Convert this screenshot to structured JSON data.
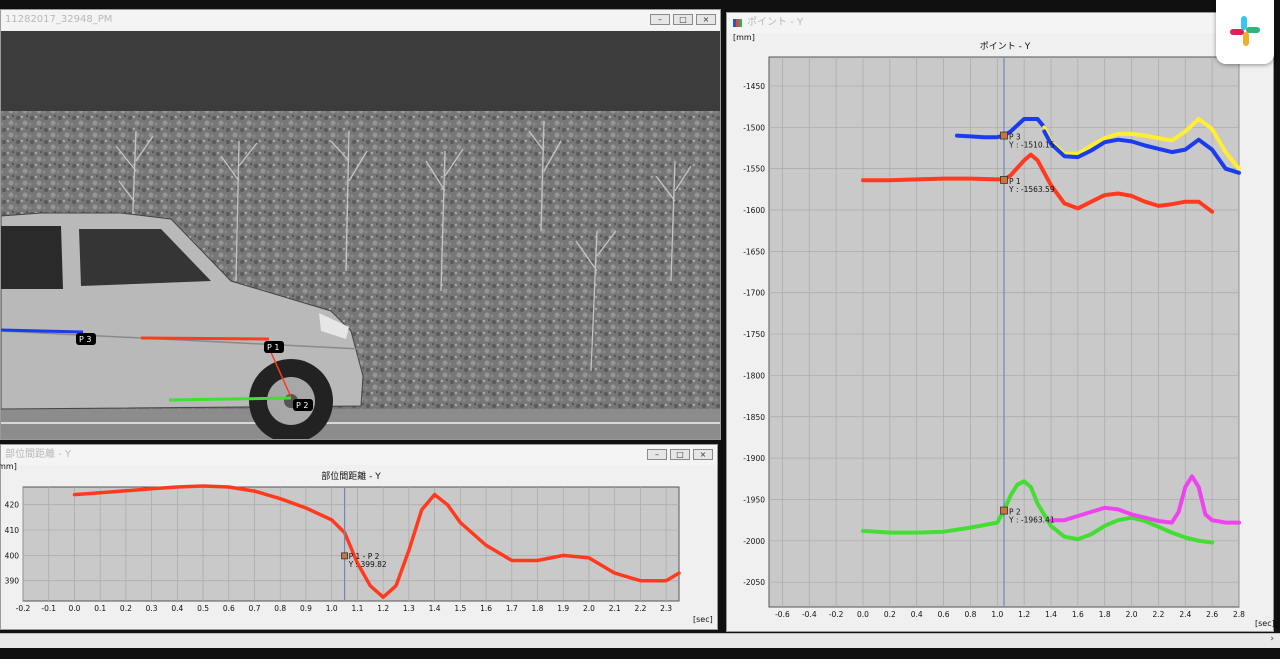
{
  "video_window": {
    "title": "11282017_32948_PM",
    "markers": {
      "p1": "P 1",
      "p2": "P 2",
      "p3": "P 3"
    }
  },
  "position_window": {
    "title": "ポイント - Y",
    "plot_title": "ポイント - Y",
    "y_unit": "[mm]",
    "x_unit": "[sec]",
    "x_ticks": [
      "-0.6",
      "-0.4",
      "-0.2",
      "0.0",
      "0.2",
      "0.4",
      "0.6",
      "0.8",
      "1.0",
      "1.2",
      "1.4",
      "1.6",
      "1.8",
      "2.0",
      "2.2",
      "2.4",
      "2.6",
      "2.8"
    ],
    "y_ticks": [
      "-1450",
      "-1500",
      "-1550",
      "-1600",
      "-1650",
      "-1700",
      "-1750",
      "-1800",
      "-1850",
      "-1900",
      "-1950",
      "-2000",
      "-2050"
    ],
    "cursors": [
      {
        "name": "P 3",
        "value": "Y : -1510.15"
      },
      {
        "name": "P 1",
        "value": "Y : -1563.59"
      },
      {
        "name": "P 2",
        "value": "Y : -1963.41"
      }
    ]
  },
  "distance_window": {
    "title": "部位間距離 - Y",
    "plot_title": "部位間距離 - Y",
    "y_unit": "[mm]",
    "x_unit": "[sec]",
    "x_ticks": [
      "-0.2",
      "-0.1",
      "0.0",
      "0.1",
      "0.2",
      "0.3",
      "0.4",
      "0.5",
      "0.6",
      "0.7",
      "0.8",
      "0.9",
      "1.0",
      "1.1",
      "1.2",
      "1.3",
      "1.4",
      "1.5",
      "1.6",
      "1.7",
      "1.8",
      "1.9",
      "2.0",
      "2.1",
      "2.2",
      "2.3"
    ],
    "y_ticks": [
      "420",
      "410",
      "400",
      "390"
    ],
    "cursor_name": "P 1 - P 2",
    "cursor_value": "Y : 399.82"
  },
  "colors": {
    "p1": "#ff3a1e",
    "p2": "#44dd33",
    "p3": "#1a3cf0",
    "yellow": "#ffee33",
    "magenta": "#ee44ee"
  },
  "chart_data": [
    {
      "type": "line",
      "title": "ポイント - Y",
      "xlim": [
        -0.7,
        2.8
      ],
      "ylim": [
        -2080,
        -1415
      ],
      "grid": true,
      "series": [
        {
          "name": "P 3",
          "x": [
            0.7,
            0.8,
            0.9,
            1.0,
            1.05,
            1.1,
            1.2,
            1.3,
            1.35
          ],
          "y": [
            -1510,
            -1511,
            -1512,
            -1512,
            -1510,
            -1505,
            -1490,
            -1490,
            -1500
          ]
        },
        {
          "name": "",
          "x": [
            1.35,
            1.4,
            1.5,
            1.6,
            1.7,
            1.8,
            1.9,
            2.0,
            2.1,
            2.2,
            2.3,
            2.4,
            2.5,
            2.6,
            2.7,
            2.8
          ],
          "y": [
            -1500,
            -1518,
            -1532,
            -1532,
            -1522,
            -1513,
            -1508,
            -1508,
            -1510,
            -1513,
            -1516,
            -1505,
            -1490,
            -1502,
            -1530,
            -1550
          ]
        },
        {
          "name": "",
          "x": [
            1.35,
            1.4,
            1.5,
            1.6,
            1.7,
            1.8,
            1.9,
            2.0,
            2.1,
            2.2,
            2.3,
            2.4,
            2.5,
            2.6,
            2.7,
            2.8
          ],
          "y": [
            -1505,
            -1520,
            -1535,
            -1536,
            -1528,
            -1518,
            -1515,
            -1517,
            -1522,
            -1526,
            -1530,
            -1527,
            -1515,
            -1527,
            -1550,
            -1555
          ]
        },
        {
          "name": "P 1",
          "x": [
            0.0,
            0.2,
            0.4,
            0.6,
            0.8,
            1.0,
            1.05,
            1.1,
            1.2,
            1.25,
            1.3,
            1.4,
            1.5,
            1.6,
            1.7,
            1.8,
            1.9,
            2.0,
            2.1,
            2.2,
            2.3,
            2.4,
            2.5,
            2.6
          ],
          "y": [
            -1564,
            -1564,
            -1563,
            -1562,
            -1562,
            -1563,
            -1563,
            -1558,
            -1540,
            -1533,
            -1540,
            -1570,
            -1592,
            -1598,
            -1590,
            -1582,
            -1580,
            -1583,
            -1590,
            -1595,
            -1593,
            -1590,
            -1590,
            -1602
          ]
        },
        {
          "name": "P 2",
          "x": [
            0.0,
            0.2,
            0.4,
            0.6,
            0.8,
            1.0,
            1.05,
            1.1,
            1.15,
            1.2,
            1.25,
            1.3,
            1.4,
            1.5,
            1.6,
            1.7,
            1.8,
            1.9,
            2.0,
            2.1,
            2.2,
            2.3,
            2.4,
            2.5,
            2.6
          ],
          "y": [
            -1988,
            -1990,
            -1990,
            -1989,
            -1984,
            -1978,
            -1963,
            -1945,
            -1932,
            -1928,
            -1935,
            -1955,
            -1982,
            -1995,
            -1998,
            -1992,
            -1982,
            -1975,
            -1972,
            -1976,
            -1983,
            -1990,
            -1996,
            -2000,
            -2002
          ]
        },
        {
          "name": "",
          "x": [
            1.4,
            1.5,
            1.6,
            1.7,
            1.8,
            1.9,
            2.0,
            2.1,
            2.2,
            2.3,
            2.35,
            2.4,
            2.45,
            2.5,
            2.55,
            2.6,
            2.7,
            2.8
          ],
          "y": [
            -1975,
            -1975,
            -1970,
            -1965,
            -1960,
            -1962,
            -1968,
            -1972,
            -1976,
            -1978,
            -1965,
            -1935,
            -1922,
            -1935,
            -1968,
            -1975,
            -1978,
            -1978
          ]
        }
      ]
    },
    {
      "type": "line",
      "title": "部位間距離 - Y",
      "xlim": [
        -0.2,
        2.35
      ],
      "ylim": [
        382,
        427
      ],
      "grid": true,
      "series": [
        {
          "name": "P 1 - P 2",
          "x": [
            0.0,
            0.1,
            0.2,
            0.3,
            0.4,
            0.5,
            0.6,
            0.7,
            0.8,
            0.9,
            1.0,
            1.05,
            1.1,
            1.15,
            1.2,
            1.25,
            1.3,
            1.35,
            1.4,
            1.45,
            1.5,
            1.6,
            1.7,
            1.8,
            1.9,
            2.0,
            2.1,
            2.2,
            2.3,
            2.35
          ],
          "y": [
            424,
            424.7,
            425.5,
            426.3,
            427,
            427.4,
            427,
            425.4,
            422.4,
            418.7,
            414,
            409,
            397,
            388,
            383.5,
            388,
            402,
            418,
            424,
            420,
            413,
            404,
            398,
            398,
            400,
            399,
            393,
            390,
            390,
            393
          ]
        }
      ]
    }
  ]
}
